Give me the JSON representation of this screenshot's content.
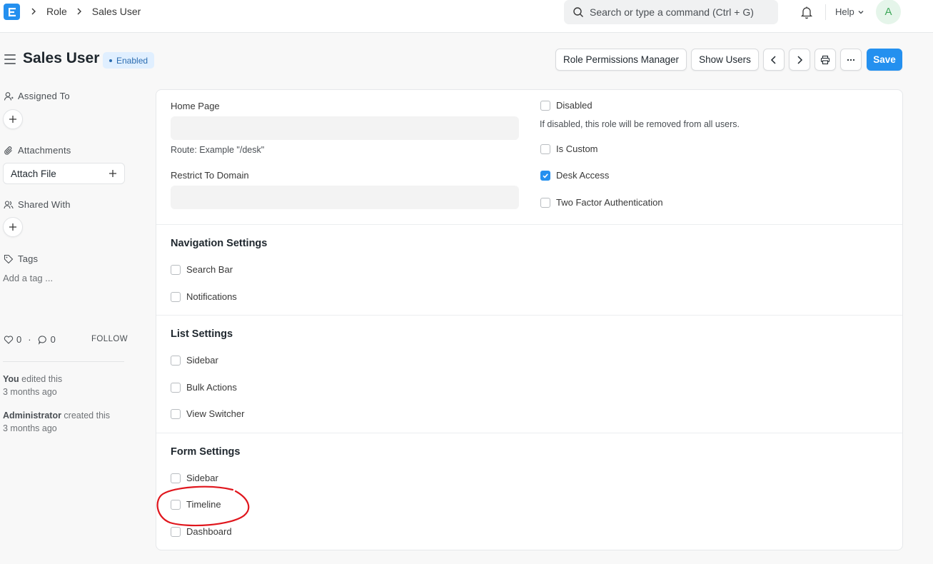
{
  "navbar": {
    "breadcrumbs": [
      "Role",
      "Sales User"
    ],
    "search_placeholder": "Search or type a command (Ctrl + G)",
    "help_label": "Help",
    "avatar_initial": "A"
  },
  "header": {
    "title": "Sales User",
    "status": "Enabled",
    "buttons": {
      "role_permissions": "Role Permissions Manager",
      "show_users": "Show Users",
      "save": "Save"
    }
  },
  "sidebar": {
    "assigned_to": "Assigned To",
    "attachments": "Attachments",
    "attach_file": "Attach File",
    "shared_with": "Shared With",
    "tags": "Tags",
    "add_tag": "Add a tag ...",
    "likes_count": "0",
    "comments_count": "0",
    "separator": "·",
    "follow": "FOLLOW",
    "activity": [
      {
        "actor": "You",
        "action": " edited this",
        "time": "3 months ago"
      },
      {
        "actor": "Administrator",
        "action": " created this",
        "time": "3 months ago"
      }
    ]
  },
  "form": {
    "home_page_label": "Home Page",
    "home_page_value": "",
    "route_hint": "Route: Example \"/desk\"",
    "restrict_domain_label": "Restrict To Domain",
    "restrict_domain_value": "",
    "disabled_label": "Disabled",
    "disabled_checked": false,
    "disabled_desc": "If disabled, this role will be removed from all users.",
    "is_custom_label": "Is Custom",
    "is_custom_checked": false,
    "desk_access_label": "Desk Access",
    "desk_access_checked": true,
    "two_factor_label": "Two Factor Authentication",
    "two_factor_checked": false,
    "navigation_settings": {
      "title": "Navigation Settings",
      "items": [
        {
          "label": "Search Bar",
          "checked": false
        },
        {
          "label": "Notifications",
          "checked": false
        }
      ]
    },
    "list_settings": {
      "title": "List Settings",
      "items": [
        {
          "label": "Sidebar",
          "checked": false
        },
        {
          "label": "Bulk Actions",
          "checked": false
        },
        {
          "label": "View Switcher",
          "checked": false
        }
      ]
    },
    "form_settings": {
      "title": "Form Settings",
      "items": [
        {
          "label": "Sidebar",
          "checked": false
        },
        {
          "label": "Timeline",
          "checked": false
        },
        {
          "label": "Dashboard",
          "checked": false
        }
      ]
    }
  },
  "colors": {
    "primary": "#2490ef",
    "badge_bg": "#e0efff",
    "annotation": "#e0161d"
  }
}
